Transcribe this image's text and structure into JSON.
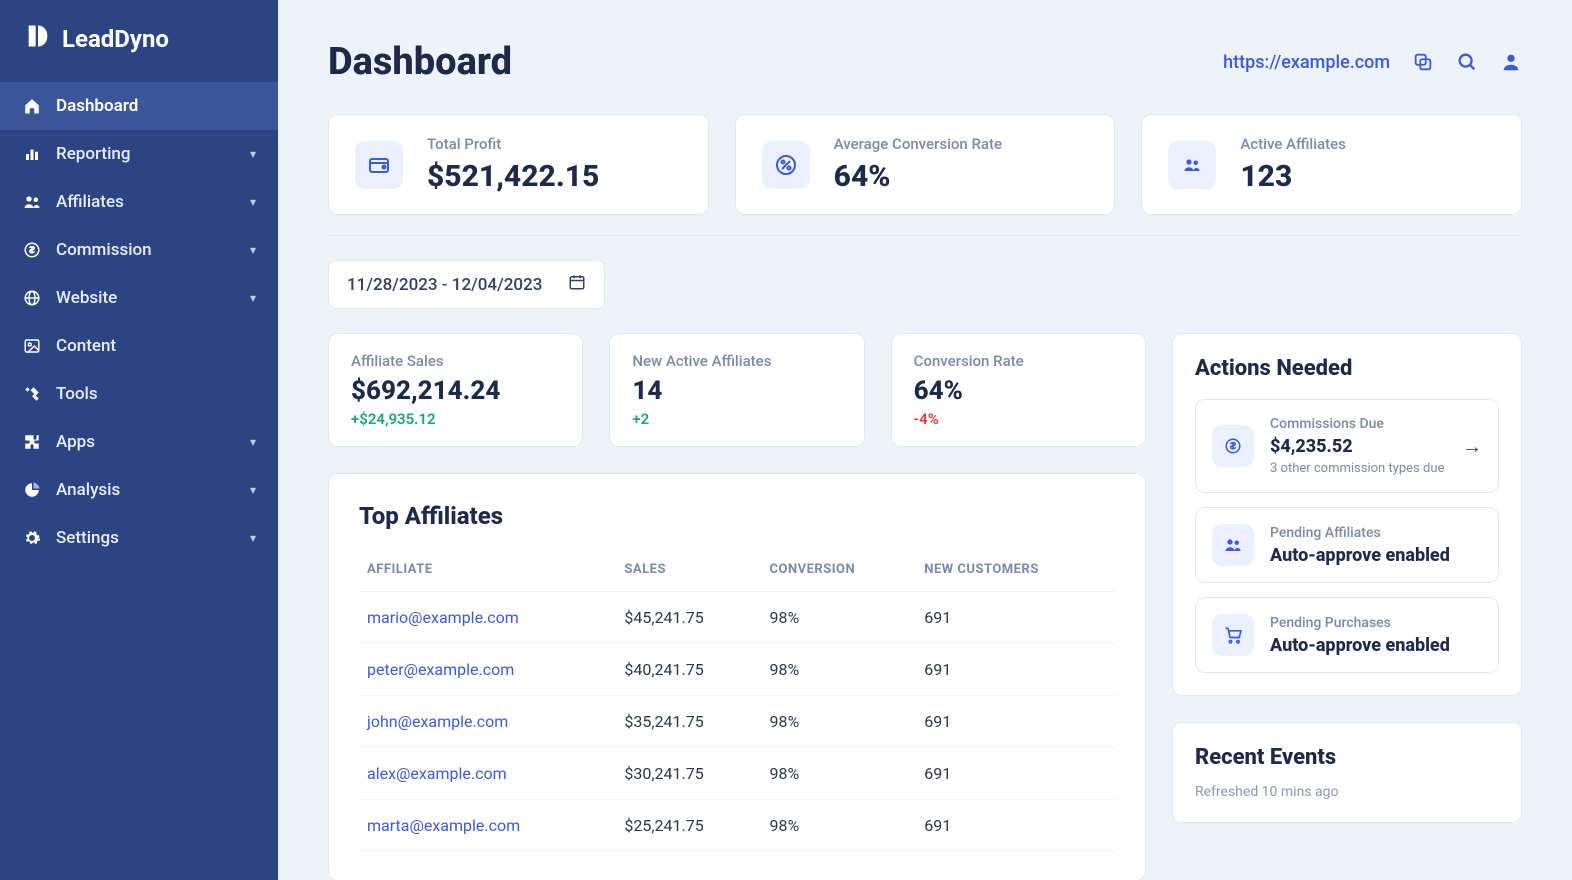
{
  "brand": {
    "name": "LeadDyno"
  },
  "sidebar": {
    "items": [
      {
        "label": "Dashboard",
        "icon": "home",
        "expandable": false,
        "active": true
      },
      {
        "label": "Reporting",
        "icon": "bar-chart",
        "expandable": true
      },
      {
        "label": "Affiliates",
        "icon": "people",
        "expandable": true
      },
      {
        "label": "Commission",
        "icon": "dollar-circle",
        "expandable": true
      },
      {
        "label": "Website",
        "icon": "globe",
        "expandable": true
      },
      {
        "label": "Content",
        "icon": "image",
        "expandable": false
      },
      {
        "label": "Tools",
        "icon": "tools",
        "expandable": false
      },
      {
        "label": "Apps",
        "icon": "puzzle",
        "expandable": true
      },
      {
        "label": "Analysis",
        "icon": "pie-chart",
        "expandable": true
      },
      {
        "label": "Settings",
        "icon": "gear",
        "expandable": true
      }
    ]
  },
  "header": {
    "title": "Dashboard",
    "site_url": "https://example.com"
  },
  "summary": [
    {
      "label": "Total Profit",
      "value": "$521,422.15",
      "icon": "wallet"
    },
    {
      "label": "Average Conversion Rate",
      "value": "64%",
      "icon": "percent"
    },
    {
      "label": "Active Affiliates",
      "value": "123",
      "icon": "people"
    }
  ],
  "date_range": "11/28/2023 - 12/04/2023",
  "period_stats": [
    {
      "label": "Affiliate Sales",
      "value": "$692,214.24",
      "delta": "+$24,935.12",
      "dir": "pos"
    },
    {
      "label": "New Active Affiliates",
      "value": "14",
      "delta": "+2",
      "dir": "pos"
    },
    {
      "label": "Conversion Rate",
      "value": "64%",
      "delta": "-4%",
      "dir": "neg"
    }
  ],
  "top_affiliates": {
    "title": "Top Affiliates",
    "columns": [
      "AFFILIATE",
      "SALES",
      "CONVERSION",
      "NEW CUSTOMERS"
    ],
    "rows": [
      {
        "affiliate": "mario@example.com",
        "sales": "$45,241.75",
        "conversion": "98%",
        "new_customers": "691"
      },
      {
        "affiliate": "peter@example.com",
        "sales": "$40,241.75",
        "conversion": "98%",
        "new_customers": "691"
      },
      {
        "affiliate": "john@example.com",
        "sales": "$35,241.75",
        "conversion": "98%",
        "new_customers": "691"
      },
      {
        "affiliate": "alex@example.com",
        "sales": "$30,241.75",
        "conversion": "98%",
        "new_customers": "691"
      },
      {
        "affiliate": "marta@example.com",
        "sales": "$25,241.75",
        "conversion": "98%",
        "new_customers": "691"
      }
    ]
  },
  "actions": {
    "title": "Actions Needed",
    "items": [
      {
        "icon": "dollar-circle",
        "label": "Commissions Due",
        "value": "$4,235.52",
        "sub": "3 other commission types due",
        "arrow": true
      },
      {
        "icon": "people",
        "label": "Pending Affiliates",
        "value": "Auto-approve enabled"
      },
      {
        "icon": "cart",
        "label": "Pending Purchases",
        "value": "Auto-approve enabled"
      }
    ]
  },
  "recent": {
    "title": "Recent Events",
    "subtitle": "Refreshed 10 mins ago"
  }
}
